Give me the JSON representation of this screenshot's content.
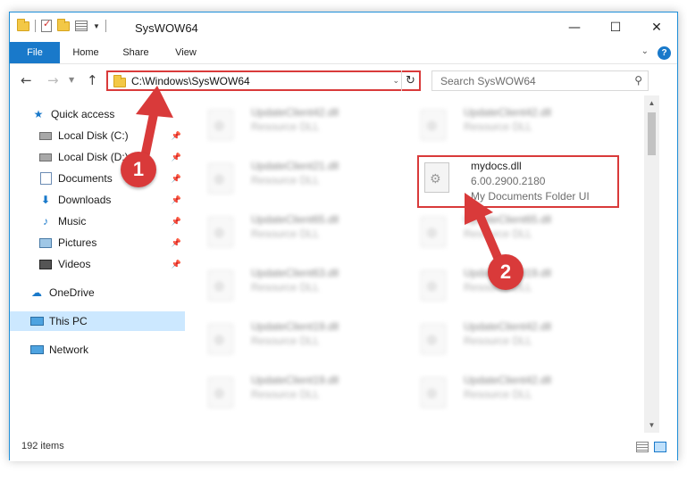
{
  "window": {
    "title": "SysWOW64"
  },
  "window_controls": {
    "minimize": "—",
    "maximize": "☐",
    "close": "✕"
  },
  "ribbon": {
    "tabs": [
      "File",
      "Home",
      "Share",
      "View"
    ],
    "help": "?"
  },
  "address": {
    "path": "C:\\Windows\\SysWOW64"
  },
  "search": {
    "placeholder": "Search SysWOW64"
  },
  "sidebar": {
    "items": [
      {
        "label": "Quick access",
        "icon": "star-icon"
      },
      {
        "label": "Local Disk (C:)",
        "icon": "drive-icon",
        "pinned": true
      },
      {
        "label": "Local Disk (D:)",
        "icon": "drive-icon",
        "pinned": true
      },
      {
        "label": "Documents",
        "icon": "documents-icon",
        "pinned": true
      },
      {
        "label": "Downloads",
        "icon": "downloads-icon",
        "pinned": true
      },
      {
        "label": "Music",
        "icon": "music-icon",
        "pinned": true
      },
      {
        "label": "Pictures",
        "icon": "pictures-icon",
        "pinned": true
      },
      {
        "label": "Videos",
        "icon": "videos-icon",
        "pinned": true
      },
      {
        "label": "OneDrive",
        "icon": "onedrive-icon"
      },
      {
        "label": "This PC",
        "icon": "this-pc-icon",
        "selected": true
      },
      {
        "label": "Network",
        "icon": "network-icon"
      }
    ]
  },
  "files": {
    "left": [
      {
        "name": "UpdateClient42.dll",
        "desc": "Resource DLL"
      },
      {
        "name": "UpdateClient21.dll",
        "desc": "Resource DLL"
      },
      {
        "name": "UpdateClient65.dll",
        "desc": "Resource DLL"
      },
      {
        "name": "UpdateClient63.dll",
        "desc": "Resource DLL"
      },
      {
        "name": "UpdateClient19.dll",
        "desc": "Resource DLL"
      },
      {
        "name": "UpdateClient19.dll",
        "desc": "Resource DLL"
      }
    ],
    "right": [
      {
        "name": "UpdateClient42.dll",
        "desc": "Resource DLL"
      },
      {
        "name": "UpdateClient65.dll",
        "desc": "Resource DLL"
      },
      {
        "name": "UpdateClient19.dll",
        "desc": "Resource DLL"
      },
      {
        "name": "UpdateClient42.dll",
        "desc": "Resource DLL"
      },
      {
        "name": "UpdateClient42.dll",
        "desc": "Resource DLL"
      }
    ],
    "highlighted": {
      "name": "mydocs.dll",
      "version": "6.00.2900.2180",
      "desc": "My Documents Folder UI"
    }
  },
  "status": {
    "count": "192 items"
  },
  "annotations": {
    "marker1": "1",
    "marker2": "2",
    "color": "#d93a3a"
  }
}
